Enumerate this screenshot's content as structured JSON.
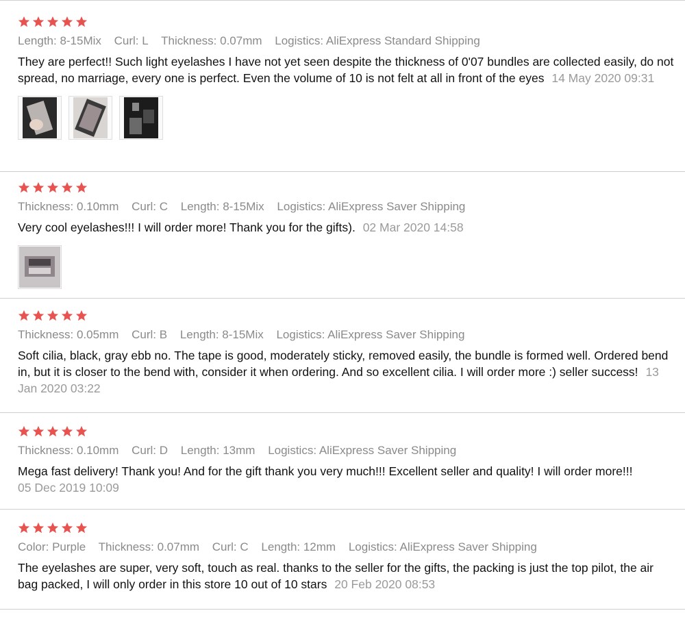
{
  "colors": {
    "star": "#e8524f",
    "meta": "#8a8a8a",
    "text": "#111111"
  },
  "reviews": [
    {
      "stars": 5,
      "attrs": [
        "Length: 8-15Mix",
        "Curl: L",
        "Thickness: 0.07mm",
        "Logistics: AliExpress Standard Shipping"
      ],
      "text": "They are perfect!! Such light eyelashes I have not yet seen despite the thickness of 0'07 bundles are collected easily, do not spread, no marriage, every one is perfect. Even the volume of 10 is not felt at all in front of the eyes",
      "date": "14 May 2020 09:31",
      "photos": [
        "review-photo-1",
        "review-photo-2",
        "review-photo-3"
      ]
    },
    {
      "stars": 5,
      "attrs": [
        "Thickness: 0.10mm",
        "Curl: C",
        "Length: 8-15Mix",
        "Logistics: AliExpress Saver Shipping"
      ],
      "text": "Very cool eyelashes!!! I will order more! Thank you for the gifts).",
      "date": "02 Mar 2020 14:58",
      "photos": [
        "review-photo-1"
      ]
    },
    {
      "stars": 5,
      "attrs": [
        "Thickness: 0.05mm",
        "Curl: B",
        "Length: 8-15Mix",
        "Logistics: AliExpress Saver Shipping"
      ],
      "text": "Soft cilia, black, gray ebb no. The tape is good, moderately sticky, removed easily, the bundle is formed well. Ordered bend in, but it is closer to the bend with, consider it when ordering. And so excellent cilia. I will order more :) seller success!",
      "date": "13 Jan 2020 03:22",
      "photos": []
    },
    {
      "stars": 5,
      "attrs": [
        "Thickness: 0.10mm",
        "Curl: D",
        "Length: 13mm",
        "Logistics: AliExpress Saver Shipping"
      ],
      "text": "Mega fast delivery! Thank you! And for the gift thank you very much!!! Excellent seller and quality! I will order more!!!",
      "date": "05 Dec 2019 10:09",
      "photos": []
    },
    {
      "stars": 5,
      "attrs": [
        "Color: Purple",
        "Thickness: 0.07mm",
        "Curl: C",
        "Length: 12mm",
        "Logistics: AliExpress Saver Shipping"
      ],
      "text": "The eyelashes are super, very soft, touch as real. thanks to the seller for the gifts, the packing is just the top pilot, the air bag packed, I will only order in this store 10 out of 10 stars",
      "date": "20 Feb 2020 08:53",
      "photos": []
    }
  ]
}
